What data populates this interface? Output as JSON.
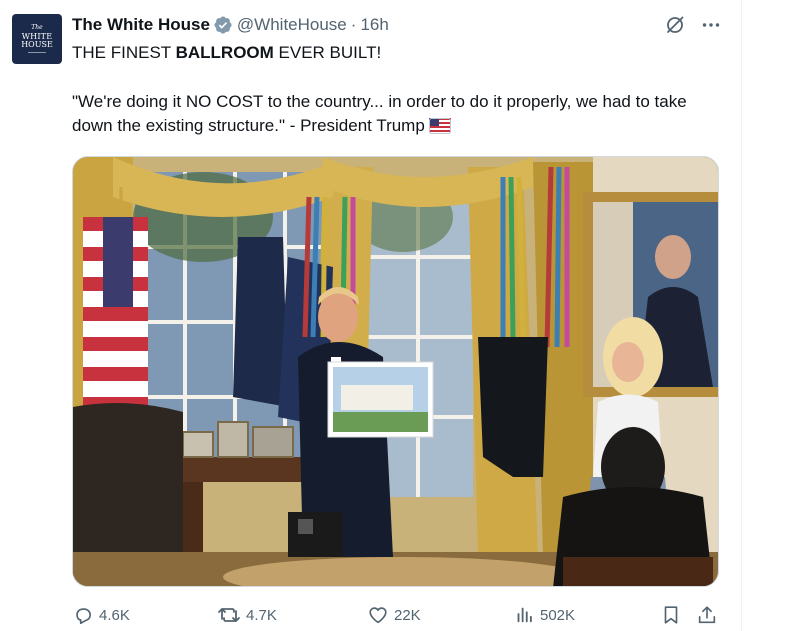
{
  "post": {
    "author_name": "The White House",
    "handle": "@WhiteHouse",
    "separator": "·",
    "time": "16h",
    "avatar": {
      "line1": "The",
      "line2": "WHITE",
      "line3": "HOUSE"
    },
    "headline_pre": "THE FINEST ",
    "headline_bold": "BALLROOM",
    "headline_post": " EVER BUILT!",
    "quote": "\"We're doing it NO COST to the country... in order to do it properly, we had to take down the existing structure.\" - President Trump",
    "flag_icon": "us-flag-emoji"
  },
  "actions": {
    "replies": "4.6K",
    "reposts": "4.7K",
    "likes": "22K",
    "views": "502K"
  },
  "colors": {
    "text_primary": "#0f1419",
    "text_secondary": "#536471",
    "verified": "#829aab",
    "border": "#cfd9de"
  }
}
